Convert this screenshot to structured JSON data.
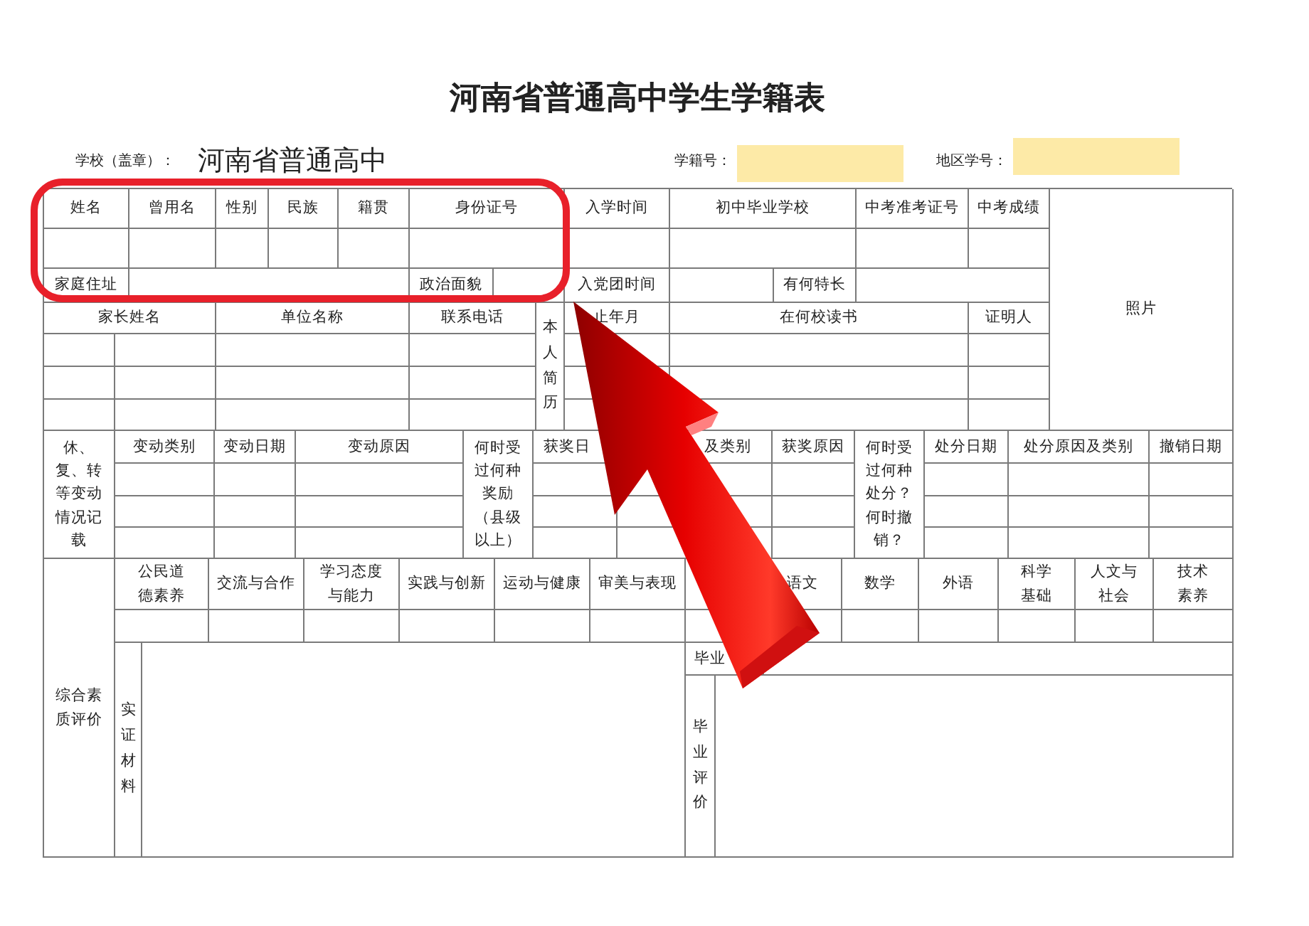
{
  "title": "河南省普通高中学生学籍表",
  "header": {
    "school_label": "学校（盖章）：",
    "school_name": "河南省普通高中",
    "student_id_label": "学籍号：",
    "region_id_label": "地区学号："
  },
  "basic_info": [
    "姓名",
    "曾用名",
    "性别",
    "民族",
    "籍贯",
    "身份证号",
    "入学时间",
    "初中毕业学校",
    "中考准考证号",
    "中考成绩",
    "照片",
    "家庭住址",
    "政治面貌",
    "入党团时间",
    "有何特长",
    "家长姓名",
    "单位名称",
    "联系电话",
    "本人简历",
    "止年月",
    "在何校读书",
    "证明人"
  ],
  "records": [
    "休、复、转等变动情况记载",
    "变动类别",
    "变动日期",
    "变动原因",
    "何时受过何种奖励（县级以上）",
    "获奖日",
    "及类别",
    "获奖原因",
    "何时受过何种处分？何时撤销？",
    "处分日期",
    "处分原因及类别",
    "撤销日期"
  ],
  "evaluation": [
    "综合素质评价",
    "公民道德素养",
    "交流与合作",
    "学习态度与能力",
    "实践与创新",
    "运动与健康",
    "审美与表现",
    "语文",
    "数学",
    "外语",
    "科学基础",
    "人文与社会",
    "技术素养",
    "实证材料",
    "毕业",
    "毕业评价"
  ]
}
